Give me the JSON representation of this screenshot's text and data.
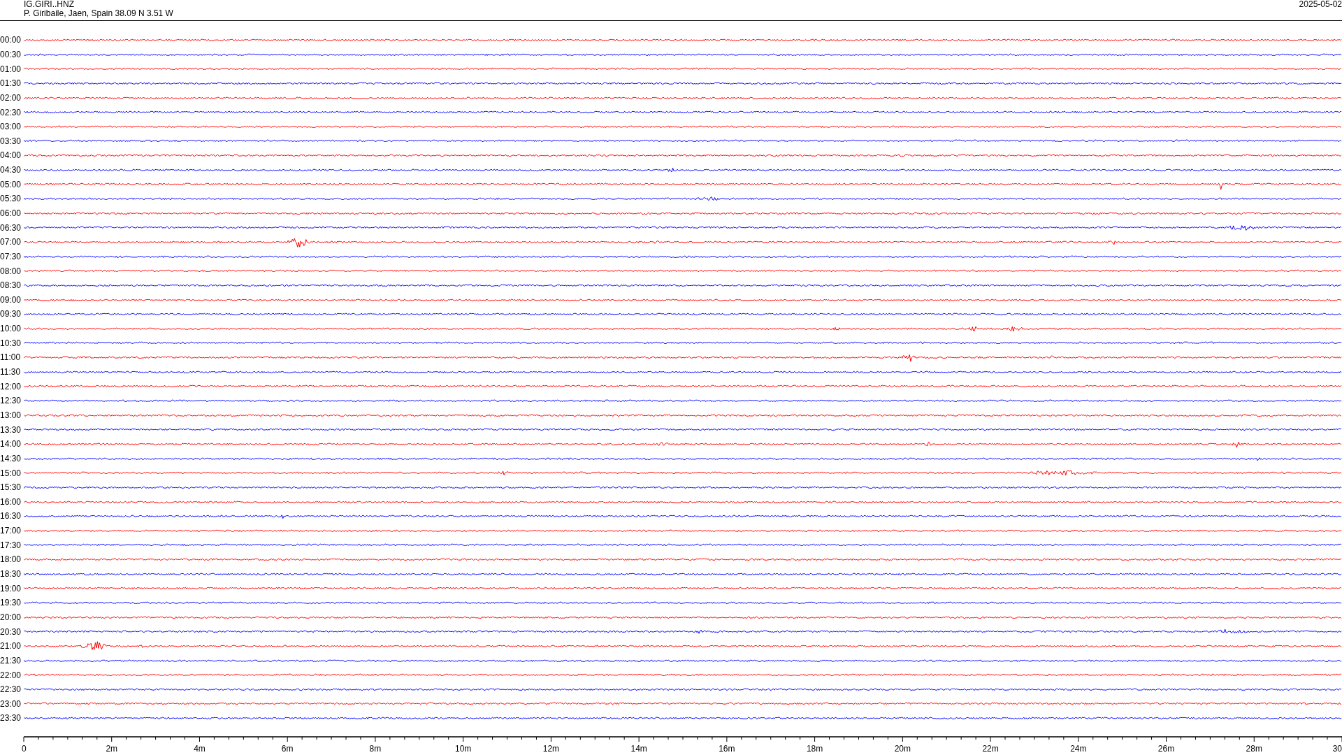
{
  "header": {
    "station": "IG.GIRI..HNZ",
    "location": "P. Giribaile, Jaen, Spain  38.09 N 3.51 W",
    "date": "2025-05-02"
  },
  "traces": [
    {
      "label": "00:00",
      "color": "#ff0000"
    },
    {
      "label": "00:30",
      "color": "#0000ff"
    },
    {
      "label": "01:00",
      "color": "#ff0000"
    },
    {
      "label": "01:30",
      "color": "#0000ff"
    },
    {
      "label": "02:00",
      "color": "#ff0000"
    },
    {
      "label": "02:30",
      "color": "#0000ff"
    },
    {
      "label": "03:00",
      "color": "#ff0000"
    },
    {
      "label": "03:30",
      "color": "#0000ff"
    },
    {
      "label": "04:00",
      "color": "#ff0000"
    },
    {
      "label": "04:30",
      "color": "#0000ff"
    },
    {
      "label": "05:00",
      "color": "#ff0000"
    },
    {
      "label": "05:30",
      "color": "#0000ff"
    },
    {
      "label": "06:00",
      "color": "#ff0000"
    },
    {
      "label": "06:30",
      "color": "#0000ff"
    },
    {
      "label": "07:00",
      "color": "#ff0000"
    },
    {
      "label": "07:30",
      "color": "#0000ff"
    },
    {
      "label": "08:00",
      "color": "#ff0000"
    },
    {
      "label": "08:30",
      "color": "#0000ff"
    },
    {
      "label": "09:00",
      "color": "#ff0000"
    },
    {
      "label": "09:30",
      "color": "#0000ff"
    },
    {
      "label": "10:00",
      "color": "#ff0000"
    },
    {
      "label": "10:30",
      "color": "#0000ff"
    },
    {
      "label": "11:00",
      "color": "#ff0000"
    },
    {
      "label": "11:30",
      "color": "#0000ff"
    },
    {
      "label": "12:00",
      "color": "#ff0000"
    },
    {
      "label": "12:30",
      "color": "#0000ff"
    },
    {
      "label": "13:00",
      "color": "#ff0000"
    },
    {
      "label": "13:30",
      "color": "#0000ff"
    },
    {
      "label": "14:00",
      "color": "#ff0000"
    },
    {
      "label": "14:30",
      "color": "#0000ff"
    },
    {
      "label": "15:00",
      "color": "#ff0000"
    },
    {
      "label": "15:30",
      "color": "#0000ff"
    },
    {
      "label": "16:00",
      "color": "#ff0000"
    },
    {
      "label": "16:30",
      "color": "#0000ff"
    },
    {
      "label": "17:00",
      "color": "#ff0000"
    },
    {
      "label": "17:30",
      "color": "#0000ff"
    },
    {
      "label": "18:00",
      "color": "#ff0000"
    },
    {
      "label": "18:30",
      "color": "#0000ff"
    },
    {
      "label": "19:00",
      "color": "#ff0000"
    },
    {
      "label": "19:30",
      "color": "#0000ff"
    },
    {
      "label": "20:00",
      "color": "#ff0000"
    },
    {
      "label": "20:30",
      "color": "#0000ff"
    },
    {
      "label": "21:00",
      "color": "#ff0000"
    },
    {
      "label": "21:30",
      "color": "#0000ff"
    },
    {
      "label": "22:00",
      "color": "#ff0000"
    },
    {
      "label": "22:30",
      "color": "#0000ff"
    },
    {
      "label": "23:00",
      "color": "#ff0000"
    },
    {
      "label": "23:30",
      "color": "#0000ff"
    }
  ],
  "x_axis": {
    "tick_labels": [
      "0",
      "2m",
      "4m",
      "6m",
      "8m",
      "10m",
      "12m",
      "14m",
      "16m",
      "18m",
      "20m",
      "22m",
      "24m",
      "26m",
      "28m",
      "30"
    ]
  }
}
